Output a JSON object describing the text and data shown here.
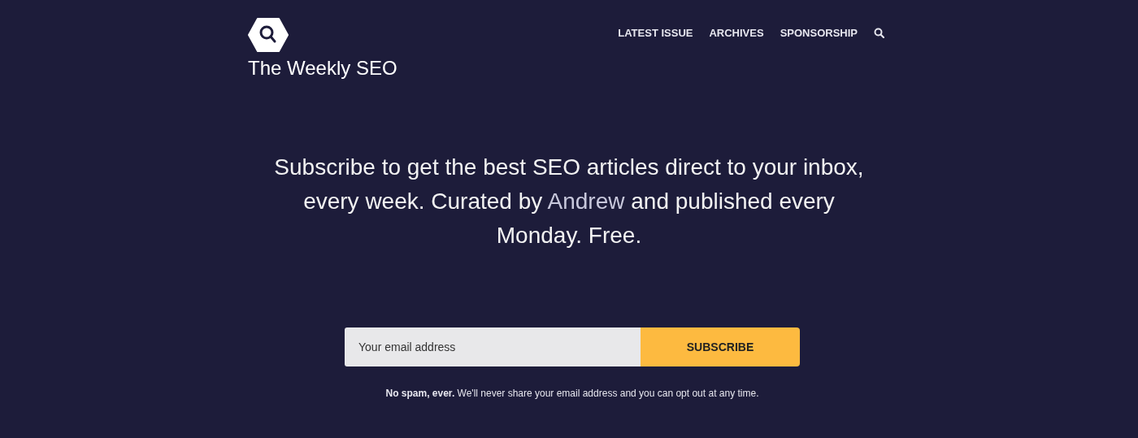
{
  "site": {
    "title": "The Weekly SEO"
  },
  "nav": [
    {
      "label": "LATEST ISSUE"
    },
    {
      "label": "ARCHIVES"
    },
    {
      "label": "SPONSORSHIP"
    }
  ],
  "headline": {
    "before": "Subscribe to get the best SEO articles direct to your inbox, every week. Curated by",
    "link": "Andrew",
    "after": "and published every Monday. Free."
  },
  "form": {
    "placeholder": "Your email address",
    "button": "SUBSCRIBE"
  },
  "note": "**No spam, ever.** We'll never share your email address and you can opt out at any time."
}
